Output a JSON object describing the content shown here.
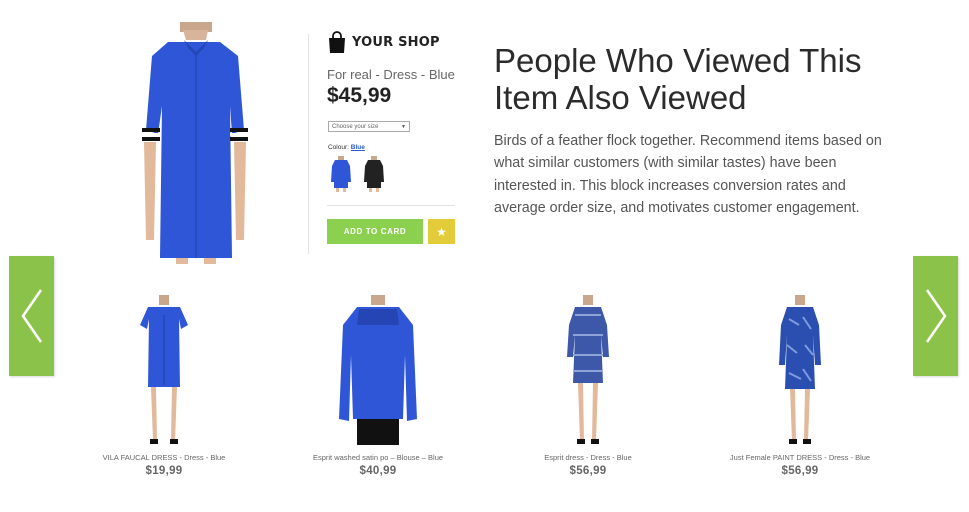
{
  "shop": {
    "name": "YOUR SHOP"
  },
  "product": {
    "title": "For real - Dress - Blue",
    "price": "$45,99",
    "size_placeholder": "Choose your size",
    "colour_label": "Colour:",
    "colour_value": "Blue",
    "add_button": "ADD TO CARD",
    "fav_icon": "star-icon"
  },
  "section": {
    "headline": "People Who Viewed This Item Also Viewed",
    "description": "Birds of a feather flock together. Recommend items based on what similar customers (with similar tastes) have been interested in. This block increases conversion rates and average order size, and motivates customer engagement."
  },
  "carousel": {
    "prev_icon": "chevron-left-icon",
    "next_icon": "chevron-right-icon",
    "items": [
      {
        "caption": "VILA FAUCAL DRESS - Dress - Blue",
        "price": "$19,99"
      },
      {
        "caption": "Esprit washed satin po – Blouse – Blue",
        "price": "$40,99"
      },
      {
        "caption": "Esprit dress - Dress - Blue",
        "price": "$56,99"
      },
      {
        "caption": "Just Female PAINT DRESS - Dress - Blue",
        "price": "$56,99"
      }
    ]
  },
  "colors": {
    "accent_green": "#8bc34a",
    "button_green": "#8bd14f",
    "fav_yellow": "#e3cc3a",
    "dress_blue": "#2f56d6"
  }
}
